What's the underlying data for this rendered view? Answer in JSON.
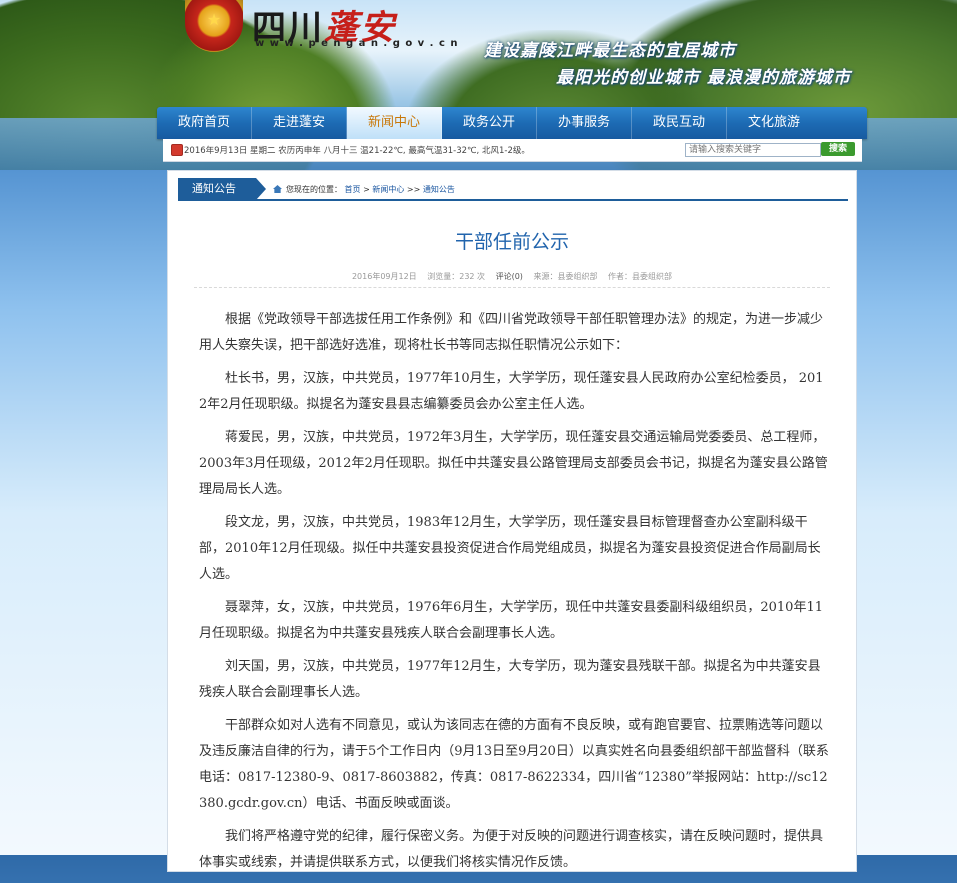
{
  "header": {
    "site_name_main": "四川",
    "site_name_accent": "蓬安",
    "site_url": "w w w . p e n g a n . g o v . c n",
    "emblem_glyph": "★",
    "slogan_line1": "建设嘉陵江畔最生态的宜居城市",
    "slogan_line2": "最阳光的创业城市 最浪漫的旅游城市"
  },
  "nav": {
    "items": [
      {
        "label": "政府首页"
      },
      {
        "label": "走进蓬安"
      },
      {
        "label": "新闻中心"
      },
      {
        "label": "政务公开"
      },
      {
        "label": "办事服务"
      },
      {
        "label": "政民互动"
      },
      {
        "label": "文化旅游"
      }
    ],
    "active_index": 2
  },
  "infobar": {
    "date_weather": "2016年9月13日 星期二 农历丙申年 八月十三  温21-22℃, 最高气温31-32℃, 北风1-2级。",
    "search_placeholder": "请输入搜索关键字",
    "search_button": "搜索"
  },
  "panel": {
    "tab_label": "通知公告",
    "breadcrumb_prefix": "您现在的位置：",
    "breadcrumb": [
      "首页",
      "新闻中心",
      "通知公告"
    ],
    "breadcrumb_sep1": " > ",
    "breadcrumb_sep2": " >> "
  },
  "article": {
    "title": "干部任前公示",
    "date": "2016年09月12日",
    "views": "浏览量：232 次",
    "comments": "评论(0)",
    "source": "来源：县委组织部",
    "author": "作者：县委组织部",
    "paragraphs": [
      "根据《党政领导干部选拔任用工作条例》和《四川省党政领导干部任职管理办法》的规定，为进一步减少用人失察失误，把干部选好选准，现将杜长书等同志拟任职情况公示如下：",
      "杜长书，男，汉族，中共党员，1977年10月生，大学学历，现任蓬安县人民政府办公室纪检委员， 2012年2月任现职级。拟提名为蓬安县县志编纂委员会办公室主任人选。",
      "蒋爱民，男，汉族，中共党员，1972年3月生，大学学历，现任蓬安县交通运输局党委委员、总工程师，2003年3月任现级，2012年2月任现职。拟任中共蓬安县公路管理局支部委员会书记，拟提名为蓬安县公路管理局局长人选。",
      "段文龙，男，汉族，中共党员，1983年12月生，大学学历，现任蓬安县目标管理督查办公室副科级干部，2010年12月任现级。拟任中共蓬安县投资促进合作局党组成员，拟提名为蓬安县投资促进合作局副局长人选。",
      "聂翠萍，女，汉族，中共党员，1976年6月生，大学学历，现任中共蓬安县委副科级组织员，2010年11月任现职级。拟提名为中共蓬安县残疾人联合会副理事长人选。",
      "刘天国，男，汉族，中共党员，1977年12月生，大专学历，现为蓬安县残联干部。拟提名为中共蓬安县残疾人联合会副理事长人选。",
      "干部群众如对人选有不同意见，或认为该同志在德的方面有不良反映，或有跑官要官、拉票贿选等问题以及违反廉洁自律的行为，请于5个工作日内（9月13日至9月20日）以真实姓名向县委组织部干部监督科（联系电话：0817-12380-9、0817-8603882，传真：0817-8622334，四川省“12380”举报网站：http://sc12380.gcdr.gov.cn）电话、书面反映或面谈。",
      "我们将严格遵守党的纪律，履行保密义务。为便于对反映的问题进行调查核实，请在反映问题时，提供具体事实或线索，并请提供联系方式，以便我们将核实情况作反馈。"
    ]
  }
}
